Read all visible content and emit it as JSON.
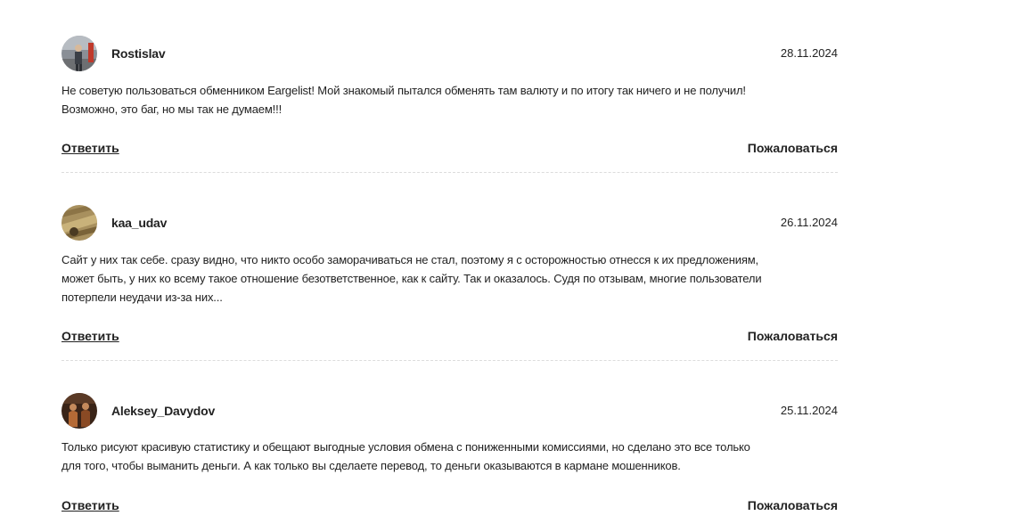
{
  "reviews": [
    {
      "username": "Rostislav",
      "date": "28.11.2024",
      "text_lines": [
        "Не советую пользоваться обменником Eargelist! Мой знакомый пытался обменять там валюту и по итогу так ничего и не получил!",
        "Возможно, это баг, но мы так не думаем!!!"
      ],
      "reply_label": "Ответить",
      "report_label": "Пожаловаться"
    },
    {
      "username": "kaa_udav",
      "date": "26.11.2024",
      "text_lines": [
        "Сайт у них так себе. сразу видно, что никто особо заморачиваться не стал, поэтому я с осторожностью отнесся к их предложениям,",
        "может быть, у них ко всему такое отношение безответственное, как к сайту. Так и оказалось. Судя по отзывам, многие пользователи",
        "потерпели неудачи из-за них..."
      ],
      "reply_label": "Ответить",
      "report_label": "Пожаловаться"
    },
    {
      "username": "Aleksey_Davydov",
      "date": "25.11.2024",
      "text_lines": [
        "Только рисуют красивую статистику и обещают выгодные условия обмена с пониженными комиссиями, но сделано это все только",
        "для того, чтобы выманить деньги. А как только вы сделаете перевод, то деньги оказываются в кармане мошенников."
      ],
      "reply_label": "Ответить",
      "report_label": "Пожаловаться"
    }
  ]
}
